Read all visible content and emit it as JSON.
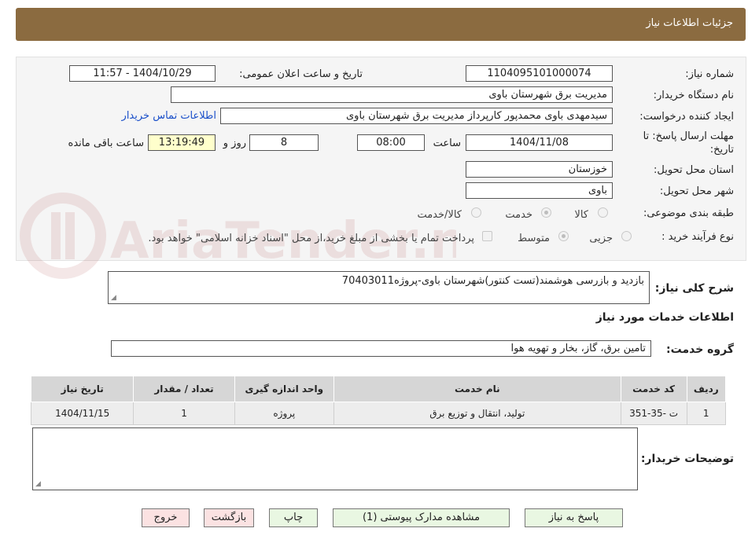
{
  "header": {
    "title": "جزئیات اطلاعات نیاز"
  },
  "form": {
    "need_number_label": "شماره نیاز:",
    "need_number": "1104095101000074",
    "announce_label": "تاریخ و ساعت اعلان عمومی:",
    "announce_value": "1404/10/29 - 11:57",
    "buyer_org_label": "نام دستگاه خریدار:",
    "buyer_org": "مدیریت برق شهرستان باوی",
    "requester_label": "ایجاد کننده درخواست:",
    "requester": "سیدمهدی باوی محمدپور کارپرداز مدیریت برق شهرستان باوی",
    "contact_link": "اطلاعات تماس خریدار",
    "deadline_label_1": "مهلت ارسال پاسخ: تا",
    "deadline_label_2": "تاریخ:",
    "deadline_date": "1404/11/08",
    "time_label": "ساعت",
    "deadline_time": "08:00",
    "days_value": "8",
    "days_label": "روز و",
    "remaining_time": "13:19:49",
    "remaining_label": "ساعت باقی مانده",
    "province_label": "استان محل تحویل:",
    "province": "خوزستان",
    "city_label": "شهر محل تحویل:",
    "city": "باوی",
    "category_label": "طبقه بندی موضوعی:",
    "category_options": [
      "کالا",
      "خدمت",
      "کالا/خدمت"
    ],
    "process_label": "نوع فرآیند خرید :",
    "process_options": [
      "جزیی",
      "متوسط"
    ],
    "payment_note": "پرداخت تمام یا بخشی از مبلغ خرید،از محل \"اسناد خزانه اسلامی\" خواهد بود."
  },
  "description": {
    "label": "شرح کلی نیاز:",
    "value": "بازدید و بازرسی هوشمند(تست کنتور)شهرستان باوی-پروژه70403011"
  },
  "services": {
    "section_title": "اطلاعات خدمات مورد نیاز",
    "group_label": "گروه خدمت:",
    "group_value": "تامین برق، گاز، بخار و تهویه هوا",
    "columns": [
      "ردیف",
      "کد خدمت",
      "نام خدمت",
      "واحد اندازه گیری",
      "تعداد / مقدار",
      "تاریخ نیاز"
    ],
    "rows": [
      [
        "1",
        "ت -35-351",
        "تولید، انتقال و توزیع برق",
        "پروژه",
        "1",
        "1404/11/15"
      ]
    ]
  },
  "buyer_notes": {
    "label": "توضیحات خریدار:",
    "value": ""
  },
  "buttons": {
    "reply": "پاسخ به نیاز",
    "attachments": "مشاهده مدارک پیوستی (1)",
    "print": "چاپ",
    "back": "بازگشت",
    "exit": "خروج"
  },
  "watermark": {
    "text": "AriaTender.neT"
  },
  "colors": {
    "header": "#8b6b40",
    "link": "#1a4fc9",
    "remaining_bg": "#ffffcc",
    "btn_green": "#e9f7e2",
    "btn_pink": "#fbe2e2"
  }
}
